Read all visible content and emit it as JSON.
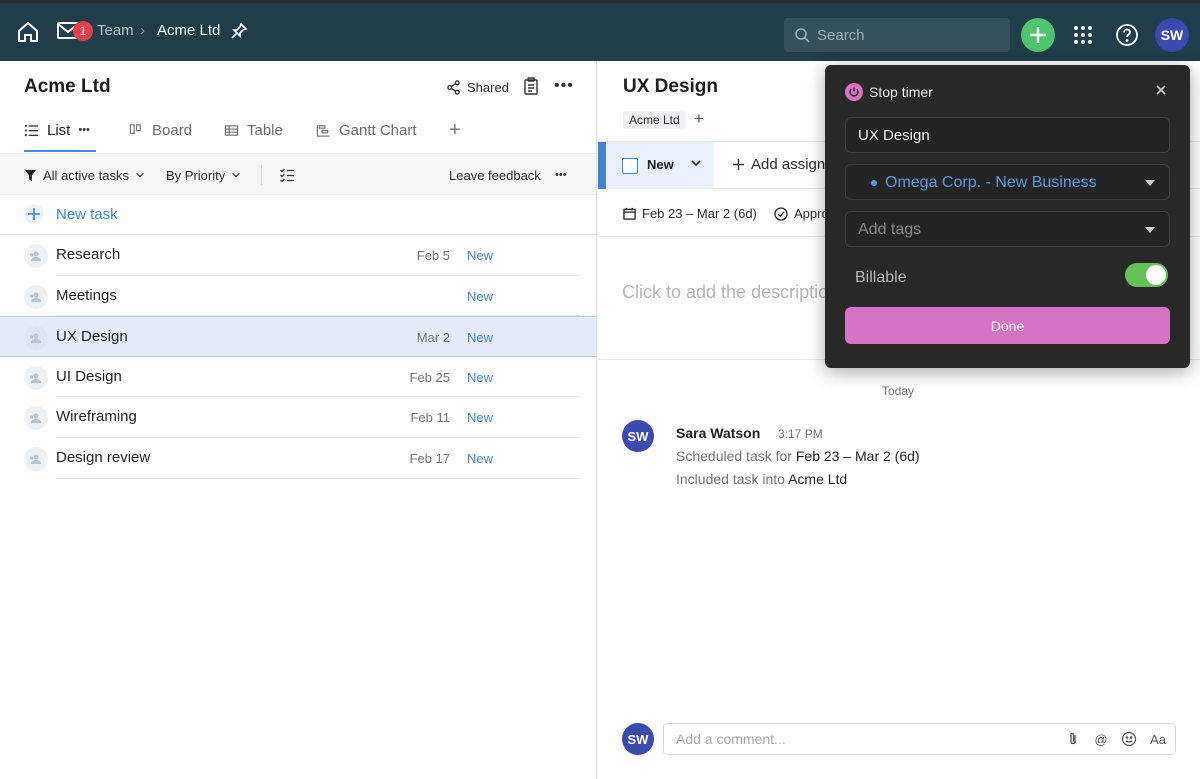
{
  "topbar": {
    "mail_badge": "1",
    "breadcrumb_team": "Team",
    "breadcrumb_separator": "›",
    "breadcrumb_current": "Acme Ltd",
    "search_placeholder": "Search",
    "avatar_initials": "SW",
    "colors": {
      "background": "#1f3d4a",
      "add_button": "#4ec46b",
      "avatar": "#3b4ab0",
      "badge": "#e0414b"
    },
    "icons": [
      "home-icon",
      "mail-icon",
      "pin-icon",
      "search-icon",
      "plus-icon",
      "apps-grid-icon",
      "help-icon"
    ]
  },
  "left_panel": {
    "title": "Acme Ltd",
    "shared_label": "Shared",
    "tabs": [
      {
        "label": "List",
        "active": true,
        "icon": "list-icon"
      },
      {
        "label": "Board",
        "active": false,
        "icon": "board-icon"
      },
      {
        "label": "Table",
        "active": false,
        "icon": "table-icon"
      },
      {
        "label": "Gantt Chart",
        "active": false,
        "icon": "gantt-icon"
      }
    ],
    "filter": {
      "active_tasks": "All active tasks",
      "priority": "By Priority",
      "feedback": "Leave feedback"
    },
    "new_task_label": "New task",
    "tasks": [
      {
        "name": "Research",
        "date": "Feb 5",
        "status": "New",
        "selected": false
      },
      {
        "name": "Meetings",
        "date": "",
        "status": "New",
        "selected": false
      },
      {
        "name": "UX Design",
        "date": "Mar 2",
        "status": "New",
        "selected": true
      },
      {
        "name": "UI Design",
        "date": "Feb 25",
        "status": "New",
        "selected": false
      },
      {
        "name": "Wireframing",
        "date": "Feb 11",
        "status": "New",
        "selected": false
      },
      {
        "name": "Design review",
        "date": "Feb 17",
        "status": "New",
        "selected": false
      }
    ],
    "colors": {
      "accent": "#3e83d2",
      "selected_row": "#e4ecfb"
    }
  },
  "right_panel": {
    "title": "UX Design",
    "breadcrumb": "Acme Ltd",
    "status_label": "New",
    "add_assignee": "Add assignee",
    "dates": "Feb 23 – Mar 2 (6d)",
    "approval": "Approval",
    "description_placeholder": "Click to add the description",
    "today_label": "Today",
    "activity": {
      "avatar_initials": "SW",
      "user": "Sara Watson",
      "time": "3:17 PM",
      "line1_prefix": "Scheduled task for ",
      "line1_value": "Feb 23 – Mar 2 (6d)",
      "line2_prefix": "Included task into ",
      "line2_value": "Acme Ltd"
    },
    "comment": {
      "avatar_initials": "SW",
      "placeholder": "Add a comment...",
      "format_label": "Aa"
    }
  },
  "timer_popup": {
    "title": "Stop timer",
    "task_value": "UX Design",
    "project": "Omega Corp. - New Business",
    "tags_placeholder": "Add tags",
    "billable_label": "Billable",
    "billable_on": true,
    "done_label": "Done",
    "colors": {
      "background": "#282828",
      "accent": "#d673c6",
      "toggle": "#63c254",
      "project": "#5c9ae0"
    }
  }
}
